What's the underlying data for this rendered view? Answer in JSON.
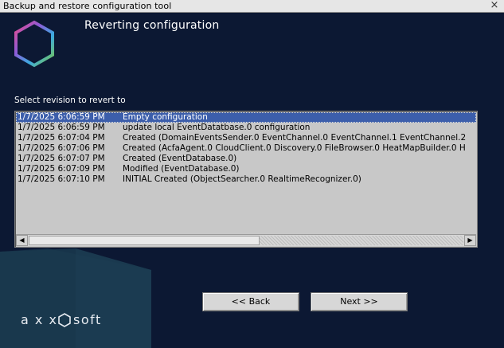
{
  "window": {
    "title": "Backup and restore configuration tool",
    "close_glyph": "×"
  },
  "header": {
    "heading": "Reverting configuration"
  },
  "revisions": {
    "label": "Select revision to revert to",
    "rows": [
      {
        "timestamp": "1/7/2025 6:06:59 PM",
        "description": "Empty configuration",
        "selected": true
      },
      {
        "timestamp": "1/7/2025 6:06:59 PM",
        "description": "update local EventDatatbase.0 configuration",
        "selected": false
      },
      {
        "timestamp": "1/7/2025 6:07:04 PM",
        "description": "Created (DomainEventsSender.0 EventChannel.0 EventChannel.1 EventChannel.2",
        "selected": false
      },
      {
        "timestamp": "1/7/2025 6:07:06 PM",
        "description": "Created (AcfaAgent.0 CloudClient.0 Discovery.0 FileBrowser.0 HeatMapBuilder.0 H",
        "selected": false
      },
      {
        "timestamp": "1/7/2025 6:07:07 PM",
        "description": "Created (EventDatabase.0)",
        "selected": false
      },
      {
        "timestamp": "1/7/2025 6:07:09 PM",
        "description": "Modified (EventDatabase.0)",
        "selected": false
      },
      {
        "timestamp": "1/7/2025 6:07:10 PM",
        "description": " INITIAL  Created (ObjectSearcher.0 RealtimeRecognizer.0)",
        "selected": false
      }
    ]
  },
  "buttons": {
    "back_label": "<< Back",
    "next_label": "Next >>"
  },
  "brand": {
    "logo_text": "axxonsoft"
  },
  "colors": {
    "background": "#0c1833",
    "selection": "#3c5eab",
    "list_background": "#c8c8c8"
  },
  "icons": {
    "logo": "hexagon-logo-icon",
    "close": "close-icon",
    "scroll_left": "arrow-left-icon",
    "scroll_right": "arrow-right-icon"
  }
}
